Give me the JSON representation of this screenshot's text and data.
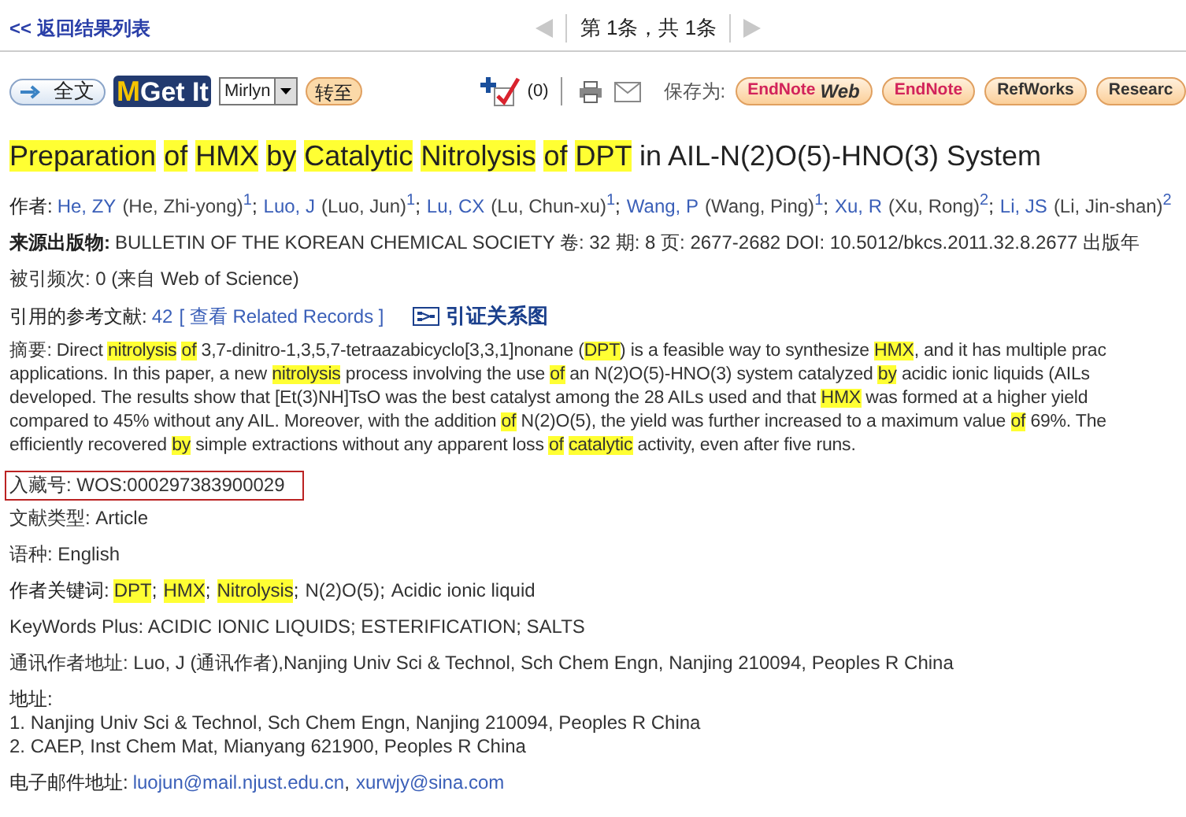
{
  "nav": {
    "back_link": "<< 返回结果列表",
    "pager": "第 1条，共 1条"
  },
  "toolbar": {
    "full_text": "全文",
    "get_it_mark": "M",
    "get_it": "Get It",
    "library_select": "Mirlyn",
    "go_button": "转至",
    "marked_count": "(0)",
    "save_label": "保存为:",
    "save_buttons": [
      {
        "kind": "endnote_web",
        "label": "EndNote",
        "suffix": "Web"
      },
      {
        "kind": "endnote",
        "label": "EndNote"
      },
      {
        "kind": "plain",
        "label": "RefWorks"
      },
      {
        "kind": "plain",
        "label": "Researc"
      }
    ]
  },
  "title": [
    {
      "text": "Preparation",
      "highlight": true
    },
    {
      "text": "of",
      "highlight": true
    },
    {
      "text": "HMX",
      "highlight": true
    },
    {
      "text": "by",
      "highlight": true
    },
    {
      "text": "Catalytic",
      "highlight": true
    },
    {
      "text": "Nitrolysis",
      "highlight": true
    },
    {
      "text": "of",
      "highlight": true
    },
    {
      "text": "DPT",
      "highlight": true
    },
    {
      "text": " in AIL-N(2)O(5)-HNO(3) System",
      "highlight": false
    }
  ],
  "authors": {
    "label": "作者:",
    "separator": ";",
    "items": [
      {
        "short": "He, ZY",
        "full": "(He, Zhi-yong)",
        "affiliation": "1"
      },
      {
        "short": "Luo, J",
        "full": "(Luo, Jun)",
        "affiliation": "1"
      },
      {
        "short": "Lu, CX",
        "full": "(Lu, Chun-xu)",
        "affiliation": "1"
      },
      {
        "short": "Wang, P",
        "full": "(Wang, Ping)",
        "affiliation": "1"
      },
      {
        "short": "Xu, R",
        "full": "(Xu, Rong)",
        "affiliation": "2"
      },
      {
        "short": "Li, JS",
        "full": "(Li, Jin-shan)",
        "affiliation": "2"
      }
    ]
  },
  "source": {
    "label": "来源出版物:",
    "value": "BULLETIN OF THE KOREAN CHEMICAL SOCIETY  卷: 32   期: 8   页: 2677-2682   DOI: 10.5012/bkcs.2011.32.8.2677   出版年"
  },
  "times_cited": "被引频次: 0 (来自 Web of Science)",
  "references": {
    "label": "引用的参考文献:",
    "count": "42",
    "related": "[ 查看 Related Records ]",
    "citation_map": "引证关系图"
  },
  "abstract": {
    "label": "摘要:",
    "lines": [
      [
        {
          "text": "Direct ",
          "highlight": false
        },
        {
          "text": "nitrolysis",
          "highlight": true
        },
        {
          "text": "of",
          "highlight": true
        },
        {
          "text": " 3,7-dinitro-1,3,5,7-tetraazabicyclo[3,3,1]nonane (",
          "highlight": false
        },
        {
          "text": "DPT",
          "highlight": true
        },
        {
          "text": ") is a feasible way to synthesize ",
          "highlight": false
        },
        {
          "text": "HMX",
          "highlight": true
        },
        {
          "text": ", and it has multiple prac",
          "highlight": false
        }
      ],
      [
        {
          "text": "applications. In this paper, a new ",
          "highlight": false
        },
        {
          "text": "nitrolysis",
          "highlight": true
        },
        {
          "text": " process involving the use ",
          "highlight": false
        },
        {
          "text": "of",
          "highlight": true
        },
        {
          "text": " an N(2)O(5)-HNO(3) system catalyzed ",
          "highlight": false
        },
        {
          "text": "by",
          "highlight": true
        },
        {
          "text": " acidic ionic liquids (AILs",
          "highlight": false
        }
      ],
      [
        {
          "text": "developed. The results show that [Et(3)NH]TsO was the best catalyst among the 28 AILs used and that ",
          "highlight": false
        },
        {
          "text": "HMX",
          "highlight": true
        },
        {
          "text": " was formed at a higher yield",
          "highlight": false
        }
      ],
      [
        {
          "text": "compared to 45% without any AIL. Moreover, with the addition ",
          "highlight": false
        },
        {
          "text": "of",
          "highlight": true
        },
        {
          "text": " N(2)O(5), the yield was further increased to a maximum value ",
          "highlight": false
        },
        {
          "text": "of",
          "highlight": true
        },
        {
          "text": " 69%. The",
          "highlight": false
        }
      ],
      [
        {
          "text": "efficiently recovered ",
          "highlight": false
        },
        {
          "text": "by",
          "highlight": true
        },
        {
          "text": " simple extractions without any apparent loss ",
          "highlight": false
        },
        {
          "text": "of",
          "highlight": true
        },
        {
          "text": "catalytic",
          "highlight": true
        },
        {
          "text": " activity, even after five runs.",
          "highlight": false
        }
      ]
    ]
  },
  "accession_number": "入藏号: WOS:000297383900029",
  "document_type": "文献类型: Article",
  "language": "语种: English",
  "author_keywords": {
    "label": "作者关键词:",
    "separator": ";",
    "items": [
      {
        "text": "DPT",
        "highlight": true
      },
      {
        "text": "HMX",
        "highlight": true
      },
      {
        "text": "Nitrolysis",
        "highlight": true
      },
      {
        "text": "N(2)O(5)",
        "highlight": false
      },
      {
        "text": "Acidic ionic liquid",
        "highlight": false
      }
    ]
  },
  "keywords_plus": "KeyWords Plus: ACIDIC IONIC LIQUIDS; ESTERIFICATION; SALTS",
  "reprint_address": "通讯作者地址: Luo, J (通讯作者),Nanjing Univ Sci & Technol, Sch Chem Engn, Nanjing 210094, Peoples R China",
  "addresses": {
    "label": "地址:",
    "items": [
      "1. Nanjing Univ Sci & Technol, Sch Chem Engn, Nanjing 210094, Peoples R China",
      "2. CAEP, Inst Chem Mat, Mianyang 621900, Peoples R China"
    ]
  },
  "emails": {
    "label": "电子邮件地址:",
    "separator": ",",
    "items": [
      "luojun@mail.njust.edu.cn",
      "xurwjy@sina.com"
    ]
  }
}
